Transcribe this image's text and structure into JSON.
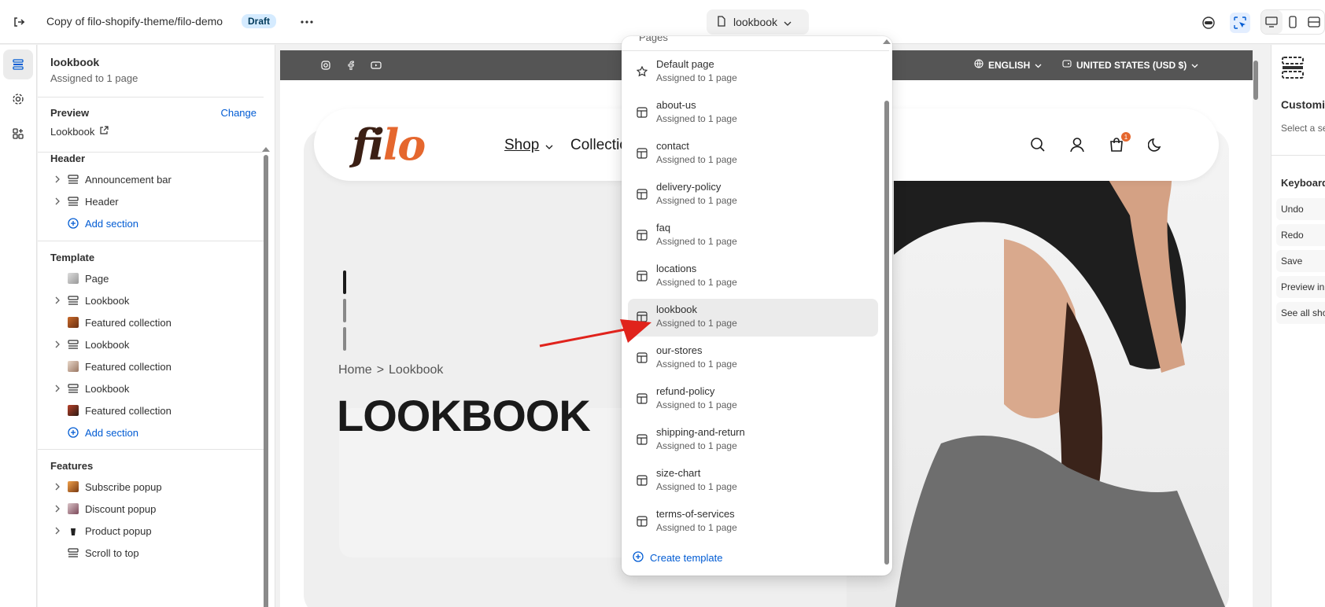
{
  "topbar": {
    "theme_name": "Copy of filo-shopify-theme/filo-demo",
    "status_badge": "Draft",
    "template_selector": "lookbook",
    "icons": [
      "exit-icon",
      "more-icon",
      "file-icon",
      "chevron-down-icon",
      "view-icon",
      "inspector-icon",
      "desktop-icon",
      "mobile-icon",
      "fullwidth-icon"
    ]
  },
  "rail": {
    "items": [
      "sections-icon",
      "settings-icon",
      "apps-icon"
    ]
  },
  "sidebar": {
    "title": "lookbook",
    "subtitle": "Assigned to 1 page",
    "preview_label": "Preview",
    "change_link": "Change",
    "preview_value": "Lookbook",
    "groups": [
      {
        "name": "Header",
        "items": [
          {
            "label": "Announcement bar",
            "expandable": true,
            "icon": "section-icon"
          },
          {
            "label": "Header",
            "expandable": true,
            "icon": "section-icon"
          },
          {
            "label": "Add section",
            "add": true
          }
        ]
      },
      {
        "name": "Template",
        "items": [
          {
            "label": "Page",
            "expandable": false,
            "icon": "page-thumb"
          },
          {
            "label": "Lookbook",
            "expandable": true,
            "icon": "section-icon"
          },
          {
            "label": "Featured collection",
            "expandable": false,
            "icon": "collection-thumb"
          },
          {
            "label": "Lookbook",
            "expandable": true,
            "icon": "section-icon"
          },
          {
            "label": "Featured collection",
            "expandable": false,
            "icon": "collection-thumb"
          },
          {
            "label": "Lookbook",
            "expandable": true,
            "icon": "section-icon"
          },
          {
            "label": "Featured collection",
            "expandable": false,
            "icon": "collection-thumb"
          },
          {
            "label": "Add section",
            "add": true
          }
        ]
      },
      {
        "name": "Features",
        "items": [
          {
            "label": "Subscribe popup",
            "expandable": true,
            "icon": "popup-thumb"
          },
          {
            "label": "Discount popup",
            "expandable": true,
            "icon": "popup-thumb"
          },
          {
            "label": "Product popup",
            "expandable": true,
            "icon": "product-thumb"
          },
          {
            "label": "Scroll to top",
            "expandable": false,
            "icon": "section-icon"
          }
        ]
      }
    ]
  },
  "store": {
    "announcement": {
      "social": [
        "instagram-icon",
        "facebook-icon",
        "youtube-icon"
      ],
      "language": "ENGLISH",
      "currency": "UNITED STATES (USD $)"
    },
    "logo_f": "fi",
    "logo_lo": "lo",
    "nav": {
      "shop": "Shop",
      "collection": "Collection"
    },
    "cart_count": "1",
    "breadcrumb_home": "Home",
    "breadcrumb_sep": ">",
    "breadcrumb_current": "Lookbook",
    "hero_title": "LOOKBOOK"
  },
  "dropdown": {
    "header": "Pages",
    "selected": "lookbook",
    "items": [
      {
        "name": "Default page",
        "assigned": "Assigned to 1 page",
        "icon": "star-icon"
      },
      {
        "name": "about-us",
        "assigned": "Assigned to 1 page",
        "icon": "template-icon"
      },
      {
        "name": "contact",
        "assigned": "Assigned to 1 page",
        "icon": "template-icon"
      },
      {
        "name": "delivery-policy",
        "assigned": "Assigned to 1 page",
        "icon": "template-icon"
      },
      {
        "name": "faq",
        "assigned": "Assigned to 1 page",
        "icon": "template-icon"
      },
      {
        "name": "locations",
        "assigned": "Assigned to 1 page",
        "icon": "template-icon"
      },
      {
        "name": "lookbook",
        "assigned": "Assigned to 1 page",
        "icon": "template-icon"
      },
      {
        "name": "our-stores",
        "assigned": "Assigned to 1 page",
        "icon": "template-icon"
      },
      {
        "name": "refund-policy",
        "assigned": "Assigned to 1 page",
        "icon": "template-icon"
      },
      {
        "name": "shipping-and-return",
        "assigned": "Assigned to 1 page",
        "icon": "template-icon"
      },
      {
        "name": "size-chart",
        "assigned": "Assigned to 1 page",
        "icon": "template-icon"
      },
      {
        "name": "terms-of-services",
        "assigned": "Assigned to 1 page",
        "icon": "template-icon"
      }
    ],
    "create_label": "Create template"
  },
  "right_panel": {
    "title": "Customiz",
    "text": "Select a se to start.",
    "keyboard_heading": "Keyboard",
    "shortcuts": [
      "Undo",
      "Redo",
      "Save",
      "Preview in",
      "See all sho"
    ]
  },
  "colors": {
    "accent": "#005bd3",
    "brand_orange": "#e5672e",
    "brand_brown": "#3b1f14",
    "annotation_arrow": "#e0231c"
  }
}
